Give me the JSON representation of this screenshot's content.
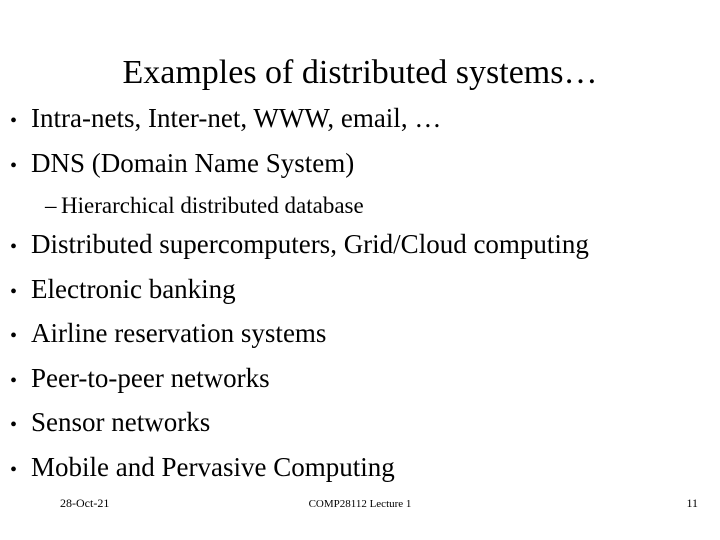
{
  "slide": {
    "title": "Examples of distributed systems…",
    "bullet_marker": "•",
    "dash_marker": "–",
    "items": [
      {
        "level": 1,
        "text": "Intra-nets, Inter-net, WWW, email, …"
      },
      {
        "level": 1,
        "text": "DNS (Domain Name System)"
      },
      {
        "level": 2,
        "text": "Hierarchical distributed database"
      },
      {
        "level": 1,
        "text": "Distributed supercomputers, Grid/Cloud computing"
      },
      {
        "level": 1,
        "text": "Electronic banking"
      },
      {
        "level": 1,
        "text": "Airline reservation systems"
      },
      {
        "level": 1,
        "text": "Peer-to-peer networks"
      },
      {
        "level": 1,
        "text": "Sensor networks"
      },
      {
        "level": 1,
        "text": "Mobile and Pervasive Computing"
      }
    ],
    "footer": {
      "date": "28-Oct-21",
      "center": "COMP28112 Lecture 1",
      "page_number": "11"
    },
    "colors": {
      "background": "#ffffff",
      "text": "#000000"
    }
  }
}
